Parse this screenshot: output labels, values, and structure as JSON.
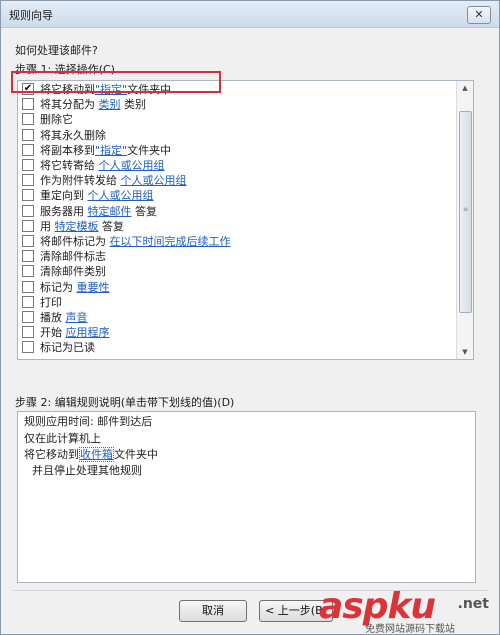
{
  "window": {
    "title": "规则向导",
    "close_symbol": "✕"
  },
  "prompt": "如何处理该邮件?",
  "step1": {
    "label": "步骤 1: 选择操作(C)"
  },
  "actions": [
    {
      "checked": true,
      "parts": [
        {
          "text": "将它移动到"
        },
        {
          "text": "\"指定\"",
          "link": true
        },
        {
          "text": "文件夹中"
        }
      ]
    },
    {
      "checked": false,
      "parts": [
        {
          "text": "将其分配为 "
        },
        {
          "text": "类别",
          "link": true
        },
        {
          "text": " 类别"
        }
      ]
    },
    {
      "checked": false,
      "parts": [
        {
          "text": "删除它"
        }
      ]
    },
    {
      "checked": false,
      "parts": [
        {
          "text": "将其永久删除"
        }
      ]
    },
    {
      "checked": false,
      "parts": [
        {
          "text": "将副本移到"
        },
        {
          "text": "\"指定\"",
          "link": true
        },
        {
          "text": "文件夹中"
        }
      ]
    },
    {
      "checked": false,
      "parts": [
        {
          "text": "将它转寄给 "
        },
        {
          "text": "个人或公用组",
          "link": true
        }
      ]
    },
    {
      "checked": false,
      "parts": [
        {
          "text": "作为附件转发给 "
        },
        {
          "text": "个人或公用组",
          "link": true
        }
      ]
    },
    {
      "checked": false,
      "parts": [
        {
          "text": "重定向到 "
        },
        {
          "text": "个人或公用组",
          "link": true
        }
      ]
    },
    {
      "checked": false,
      "parts": [
        {
          "text": "服务器用 "
        },
        {
          "text": "特定邮件",
          "link": true
        },
        {
          "text": " 答复"
        }
      ]
    },
    {
      "checked": false,
      "parts": [
        {
          "text": "用 "
        },
        {
          "text": "特定模板",
          "link": true
        },
        {
          "text": " 答复"
        }
      ]
    },
    {
      "checked": false,
      "parts": [
        {
          "text": "将邮件标记为 "
        },
        {
          "text": "在以下时间完成后续工作",
          "link": true
        }
      ]
    },
    {
      "checked": false,
      "parts": [
        {
          "text": "清除邮件标志"
        }
      ]
    },
    {
      "checked": false,
      "parts": [
        {
          "text": "清除邮件类别"
        }
      ]
    },
    {
      "checked": false,
      "parts": [
        {
          "text": "标记为 "
        },
        {
          "text": "重要性",
          "link": true
        }
      ]
    },
    {
      "checked": false,
      "parts": [
        {
          "text": "打印"
        }
      ]
    },
    {
      "checked": false,
      "parts": [
        {
          "text": "播放 "
        },
        {
          "text": "声音",
          "link": true
        }
      ]
    },
    {
      "checked": false,
      "parts": [
        {
          "text": "开始 "
        },
        {
          "text": "应用程序",
          "link": true
        }
      ]
    },
    {
      "checked": false,
      "parts": [
        {
          "text": "标记为已读"
        }
      ]
    }
  ],
  "step2": {
    "label": "步骤 2: 编辑规则说明(单击带下划线的值)(D)"
  },
  "description": {
    "line1": "规则应用时间: 邮件到达后",
    "line2": "仅在此计算机上",
    "line3_pre": "将它移动到",
    "line3_link": "收件箱",
    "line3_post": "文件夹中",
    "line4": "并且停止处理其他规则"
  },
  "buttons": {
    "cancel": "取消",
    "back": "< 上一步(B)"
  },
  "watermark": {
    "main": "aspku",
    "domain": ".net",
    "sub": "免费网站源码下载站"
  },
  "colors": {
    "link": "#1f5fbf",
    "highlight_box": "#d2303b"
  }
}
